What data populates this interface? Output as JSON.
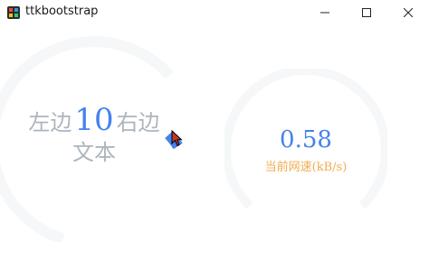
{
  "window": {
    "title": "ttkbootstrap"
  },
  "meter_left": {
    "left_text": "左边",
    "value": "10",
    "right_text": "右边",
    "subtext": "文本",
    "percent": 10,
    "colors": {
      "track": "#f5f7f9",
      "indicator": "#4582ec",
      "label": "#adb5bd"
    }
  },
  "meter_right": {
    "value": "0.58",
    "subtext": "当前网速(kB/s)",
    "colors": {
      "track": "#f5f7f9",
      "value": "#4582ec",
      "subtext": "#f0ad4e"
    }
  }
}
